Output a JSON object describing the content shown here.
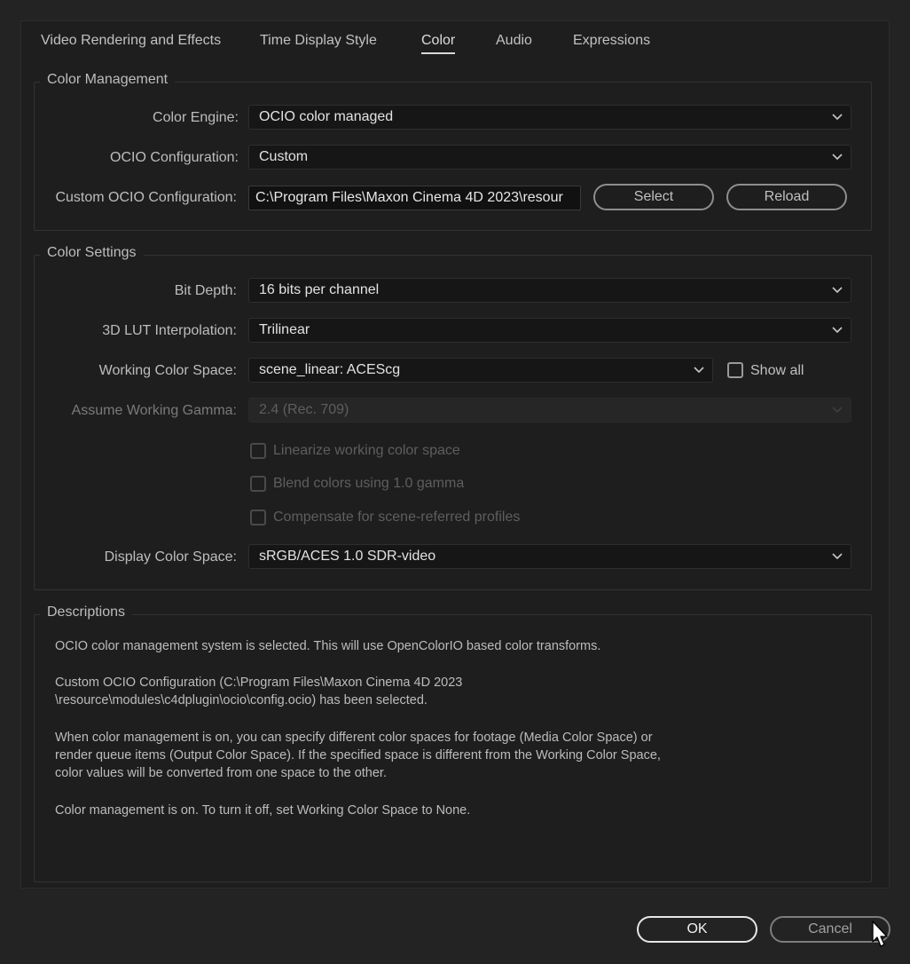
{
  "tabs": [
    {
      "label": "Video Rendering and Effects"
    },
    {
      "label": "Time Display Style"
    },
    {
      "label": "Color"
    },
    {
      "label": "Audio"
    },
    {
      "label": "Expressions"
    }
  ],
  "color_management": {
    "title": "Color Management",
    "color_engine_label": "Color Engine:",
    "color_engine_value": "OCIO color managed",
    "ocio_config_label": "OCIO Configuration:",
    "ocio_config_value": "Custom",
    "custom_ocio_label": "Custom OCIO Configuration:",
    "custom_ocio_value": "C:\\Program Files\\Maxon Cinema 4D 2023\\resour",
    "select_label": "Select",
    "reload_label": "Reload"
  },
  "color_settings": {
    "title": "Color Settings",
    "bit_depth_label": "Bit Depth:",
    "bit_depth_value": "16 bits per channel",
    "lut_label": "3D LUT Interpolation:",
    "lut_value": "Trilinear",
    "working_space_label": "Working Color Space:",
    "working_space_value": "scene_linear: ACEScg",
    "show_all_label": "Show all",
    "gamma_label": "Assume Working Gamma:",
    "gamma_value": "2.4 (Rec. 709)",
    "linearize_label": "Linearize working color space",
    "blend_label": "Blend colors using 1.0 gamma",
    "compensate_label": "Compensate for scene-referred profiles",
    "display_space_label": "Display Color Space:",
    "display_space_value": "sRGB/ACES 1.0 SDR-video"
  },
  "descriptions": {
    "title": "Descriptions",
    "p1": "OCIO color management system is selected. This will use OpenColorIO based color transforms.",
    "p2a": "Custom OCIO Configuration (C:\\Program Files\\Maxon Cinema 4D 2023",
    "p2b": "\\resource\\modules\\c4dplugin\\ocio\\config.ocio) has been selected.",
    "p3a": "When color management is on, you can specify different color spaces for footage (Media Color Space) or",
    "p3b": "render queue items (Output Color Space). If the specified space is different from the Working Color Space,",
    "p3c": "color values will be converted from one space to the other.",
    "p4": "Color management is on. To turn it off, set Working Color Space to None."
  },
  "footer": {
    "ok_label": "OK",
    "cancel_label": "Cancel"
  },
  "icons": {
    "dropdown": "chevron-down-icon",
    "cursor": "mouse-pointer-icon"
  }
}
